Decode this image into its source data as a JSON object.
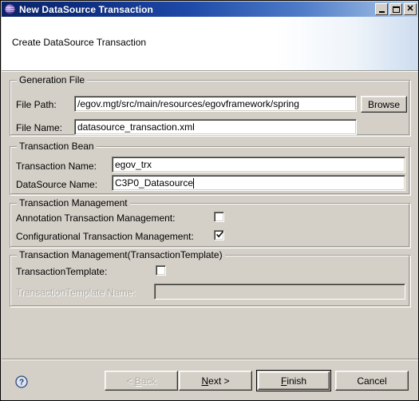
{
  "window": {
    "title": "New DataSource Transaction",
    "icon": "eclipse-globe-icon",
    "controls": {
      "minimize_label": "Minimize",
      "maximize_label": "Maximize",
      "close_label": "Close"
    }
  },
  "banner": {
    "title": "Create DataSource Transaction"
  },
  "groups": {
    "generation_file": {
      "legend": "Generation File",
      "file_path_label": "File Path:",
      "file_path_value": "/egov.mgt/src/main/resources/egovframework/spring",
      "file_name_label": "File Name:",
      "file_name_value": "datasource_transaction.xml",
      "browse_label": "Browse"
    },
    "transaction_bean": {
      "legend": "Transaction Bean",
      "transaction_name_label": "Transaction Name:",
      "transaction_name_value": "egov_trx",
      "datasource_name_label": "DataSource Name:",
      "datasource_name_value": "C3P0_Datasource"
    },
    "transaction_management": {
      "legend": "Transaction Management",
      "annotation_label": "Annotation Transaction Management:",
      "annotation_checked": false,
      "configurational_label": "Configurational Transaction Management:",
      "configurational_checked": true
    },
    "transaction_template": {
      "legend": "Transaction Management(TransactionTemplate)",
      "template_label": "TransactionTemplate:",
      "template_checked": false,
      "template_name_label": "TransactionTemplate Name:",
      "template_name_value": "",
      "template_name_disabled": true
    }
  },
  "footer": {
    "help_icon": "help-question-icon",
    "back_label": "< Back",
    "back_mnemonic": "B",
    "back_disabled": true,
    "next_label": "Next >",
    "next_mnemonic": "N",
    "finish_label": "Finish",
    "finish_mnemonic": "F",
    "finish_is_default": true,
    "cancel_label": "Cancel"
  },
  "colors": {
    "dialog_background": "#d4d0c8",
    "titlebar_start": "#0a246a",
    "titlebar_end": "#b9d0ec",
    "banner_background": "#ffffff",
    "field_background": "#ffffff",
    "disabled_text": "#adaba4"
  }
}
